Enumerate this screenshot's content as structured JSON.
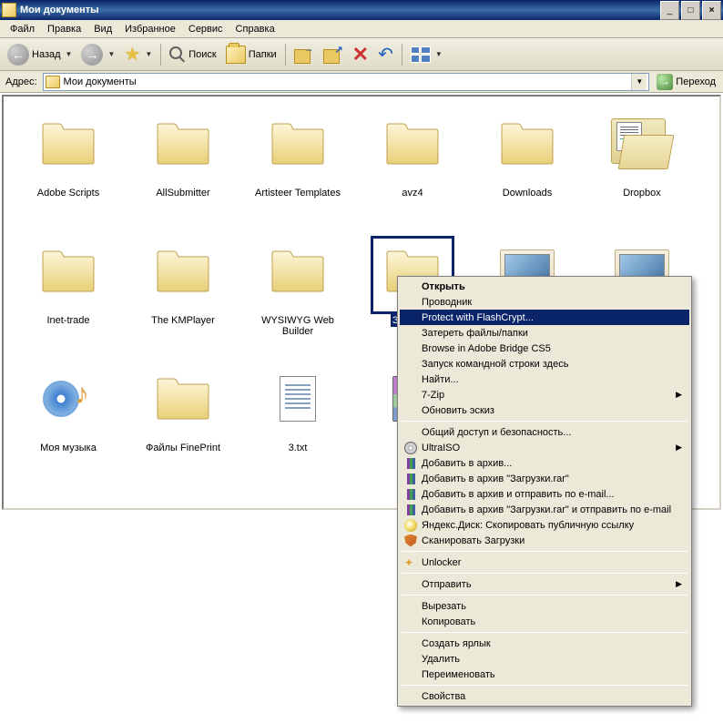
{
  "window": {
    "title": "Мои документы",
    "minimize": "_",
    "maximize": "□",
    "close": "×"
  },
  "menu": {
    "file": "Файл",
    "edit": "Правка",
    "view": "Вид",
    "favorites": "Избранное",
    "service": "Сервис",
    "help": "Справка"
  },
  "toolbar": {
    "back": "Назад",
    "search": "Поиск",
    "folders": "Папки"
  },
  "address": {
    "label": "Адрес:",
    "value": "Мои документы",
    "go": "Переход"
  },
  "items": [
    {
      "name": "Adobe Scripts",
      "type": "folder"
    },
    {
      "name": "AllSubmitter",
      "type": "folder"
    },
    {
      "name": "Artisteer Templates",
      "type": "folder"
    },
    {
      "name": "avz4",
      "type": "folder"
    },
    {
      "name": "Downloads",
      "type": "folder"
    },
    {
      "name": "Dropbox",
      "type": "open-folder"
    },
    {
      "name": "Inet-trade",
      "type": "folder"
    },
    {
      "name": "The KMPlayer",
      "type": "folder"
    },
    {
      "name": "WYSIWYG Web Builder",
      "type": "folder"
    },
    {
      "name": "Загрузки",
      "type": "folder",
      "selected": true
    },
    {
      "name": "",
      "type": "img-folder"
    },
    {
      "name": "",
      "type": "img-folder"
    },
    {
      "name": "Моя музыка",
      "type": "music"
    },
    {
      "name": "Файлы FinePrint",
      "type": "folder"
    },
    {
      "name": "3.txt",
      "type": "txt"
    },
    {
      "name": "",
      "type": "rar"
    }
  ],
  "context_menu": [
    {
      "label": "Открыть",
      "bold": true
    },
    {
      "label": "Проводник"
    },
    {
      "label": "Protect with FlashCrypt...",
      "highlighted": true
    },
    {
      "label": "Затереть файлы/папки"
    },
    {
      "label": "Browse in Adobe Bridge CS5"
    },
    {
      "label": "Запуск командной строки здесь"
    },
    {
      "label": "Найти..."
    },
    {
      "label": "7-Zip",
      "submenu": true
    },
    {
      "label": "Обновить эскиз"
    },
    {
      "sep": true
    },
    {
      "label": "Общий доступ и безопасность..."
    },
    {
      "label": "UltraISO",
      "icon": "disc",
      "submenu": true
    },
    {
      "label": "Добавить в архив...",
      "icon": "books"
    },
    {
      "label": "Добавить в архив \"Загрузки.rar\"",
      "icon": "books"
    },
    {
      "label": "Добавить в архив и отправить по e-mail...",
      "icon": "books"
    },
    {
      "label": "Добавить в архив \"Загрузки.rar\" и отправить по e-mail",
      "icon": "books"
    },
    {
      "label": "Яндекс.Диск: Скопировать публичную ссылку",
      "icon": "yd"
    },
    {
      "label": "Сканировать Загрузки",
      "icon": "shield"
    },
    {
      "sep": true
    },
    {
      "label": "Unlocker",
      "icon": "wand"
    },
    {
      "sep": true
    },
    {
      "label": "Отправить",
      "submenu": true
    },
    {
      "sep": true
    },
    {
      "label": "Вырезать"
    },
    {
      "label": "Копировать"
    },
    {
      "sep": true
    },
    {
      "label": "Создать ярлык"
    },
    {
      "label": "Удалить"
    },
    {
      "label": "Переименовать"
    },
    {
      "sep": true
    },
    {
      "label": "Свойства"
    }
  ]
}
